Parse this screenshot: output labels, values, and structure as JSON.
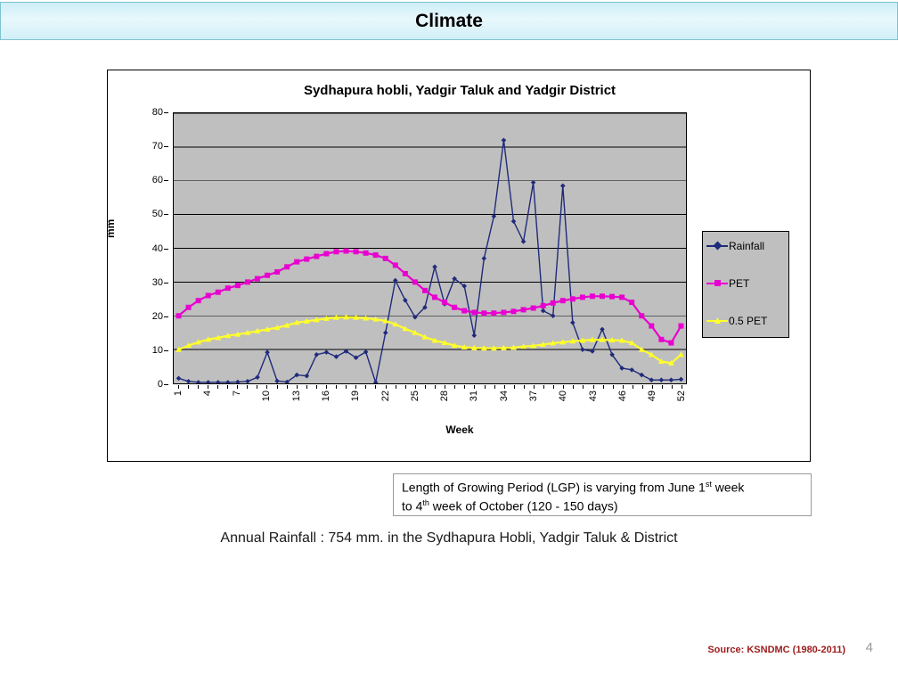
{
  "header": {
    "title": "Climate"
  },
  "chart": {
    "title": "Sydhapura hobli, Yadgir Taluk and Yadgir District",
    "xlabel": "Week",
    "ylabel": "mm"
  },
  "legend": {
    "items": [
      {
        "label": "Rainfall",
        "color": "#1f2a7a"
      },
      {
        "label": "PET",
        "color": "#e800d0"
      },
      {
        "label": "0.5 PET",
        "color": "#ffff2b"
      }
    ]
  },
  "notes": {
    "lgp_line1_a": "Length of Growing Period (LGP) is varying from June 1",
    "lgp_line1_sup": "st",
    "lgp_line1_b": " week",
    "lgp_line2_a": "to 4",
    "lgp_line2_sup": "th",
    "lgp_line2_b": " week of October (120 - 150 days)",
    "annual_rainfall": "Annual Rainfall : 754 mm. in the Sydhapura Hobli, Yadgir Taluk & District"
  },
  "footer": {
    "source": "Source: KSNDMC (1980-2011)",
    "page_number": "4"
  },
  "chart_data": {
    "type": "line",
    "title": "Sydhapura hobli, Yadgir Taluk and Yadgir District",
    "xlabel": "Week",
    "ylabel": "mm",
    "ylim": [
      0,
      80
    ],
    "yticks": [
      0,
      10,
      20,
      30,
      40,
      50,
      60,
      70,
      80
    ],
    "xticks": [
      1,
      4,
      7,
      10,
      13,
      16,
      19,
      22,
      25,
      28,
      31,
      34,
      37,
      40,
      43,
      46,
      49,
      52
    ],
    "grid": "horizontal",
    "legend_position": "right",
    "plot_background": "#bfbfbf",
    "x": [
      1,
      2,
      3,
      4,
      5,
      6,
      7,
      8,
      9,
      10,
      11,
      12,
      13,
      14,
      15,
      16,
      17,
      18,
      19,
      20,
      21,
      22,
      23,
      24,
      25,
      26,
      27,
      28,
      29,
      30,
      31,
      32,
      33,
      34,
      35,
      36,
      37,
      38,
      39,
      40,
      41,
      42,
      43,
      44,
      45,
      46,
      47,
      48,
      49,
      50,
      51,
      52
    ],
    "series": [
      {
        "name": "Rainfall",
        "color": "#1f2a7a",
        "marker": "diamond",
        "values": [
          1.5,
          0.6,
          0.3,
          0.3,
          0.3,
          0.3,
          0.4,
          0.6,
          1.8,
          9.2,
          0.7,
          0.4,
          2.5,
          2.2,
          8.5,
          9.2,
          7.9,
          9.5,
          7.6,
          9.3,
          0.3,
          15.0,
          30.5,
          24.6,
          19.6,
          22.5,
          34.5,
          23.5,
          31.0,
          28.8,
          14.2,
          37.0,
          49.5,
          72.0,
          48.0,
          42.0,
          59.5,
          21.5,
          20.0,
          58.5,
          18.0,
          10.0,
          9.5,
          16.0,
          8.5,
          4.5,
          4.0,
          2.5,
          1.0,
          1.0,
          1.0,
          1.2
        ]
      },
      {
        "name": "PET",
        "color": "#e800d0",
        "marker": "square",
        "values": [
          20.0,
          22.5,
          24.5,
          26.0,
          27.0,
          28.2,
          29.0,
          30.0,
          31.0,
          32.0,
          33.0,
          34.5,
          36.0,
          36.8,
          37.6,
          38.4,
          39.0,
          39.2,
          39.0,
          38.6,
          38.0,
          37.0,
          35.0,
          32.5,
          30.0,
          27.5,
          25.5,
          24.0,
          22.5,
          21.5,
          21.0,
          20.8,
          20.8,
          21.0,
          21.3,
          21.8,
          22.3,
          23.0,
          23.8,
          24.5,
          25.0,
          25.5,
          25.8,
          25.8,
          25.7,
          25.5,
          24.0,
          20.0,
          17.0,
          13.0,
          12.0,
          17.0
        ]
      },
      {
        "name": "0.5 PET",
        "color": "#ffff2b",
        "marker": "triangle",
        "values": [
          10.0,
          11.2,
          12.2,
          13.0,
          13.5,
          14.1,
          14.5,
          15.0,
          15.5,
          16.0,
          16.5,
          17.2,
          18.0,
          18.4,
          18.8,
          19.2,
          19.5,
          19.6,
          19.5,
          19.3,
          19.0,
          18.5,
          17.5,
          16.2,
          15.0,
          13.7,
          12.7,
          12.0,
          11.2,
          10.7,
          10.5,
          10.4,
          10.4,
          10.5,
          10.6,
          10.9,
          11.1,
          11.5,
          11.9,
          12.2,
          12.5,
          12.7,
          12.9,
          12.9,
          12.8,
          12.7,
          12.0,
          10.0,
          8.5,
          6.5,
          6.0,
          8.5
        ]
      }
    ]
  }
}
